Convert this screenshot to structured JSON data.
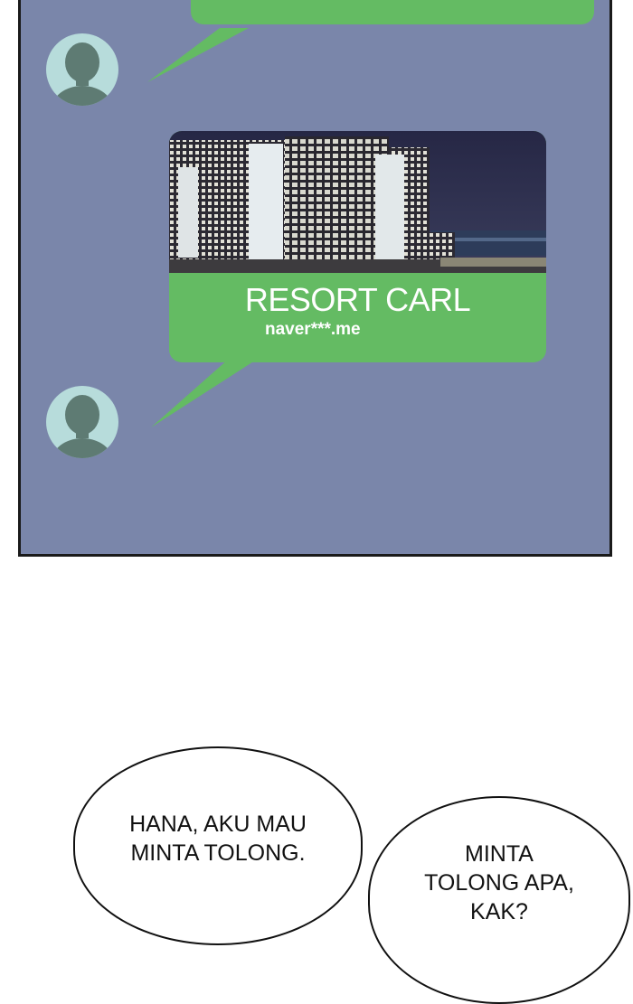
{
  "chat": {
    "link_preview": {
      "title": "RESORT CARL",
      "domain": "naver***.me"
    }
  },
  "speech": {
    "left_line1": "HANA, AKU MAU",
    "left_line2": "MINTA TOLONG.",
    "right_line1": "MINTA",
    "right_line2": "TOLONG APA,",
    "right_line3": "KAK?"
  },
  "colors": {
    "panel_bg": "#7a86aa",
    "bubble_green": "#64bb63",
    "avatar_bg": "#b7dcdb",
    "avatar_fg": "#5e7b73"
  },
  "icons": [
    "avatar-silhouette-icon",
    "building-photo"
  ]
}
